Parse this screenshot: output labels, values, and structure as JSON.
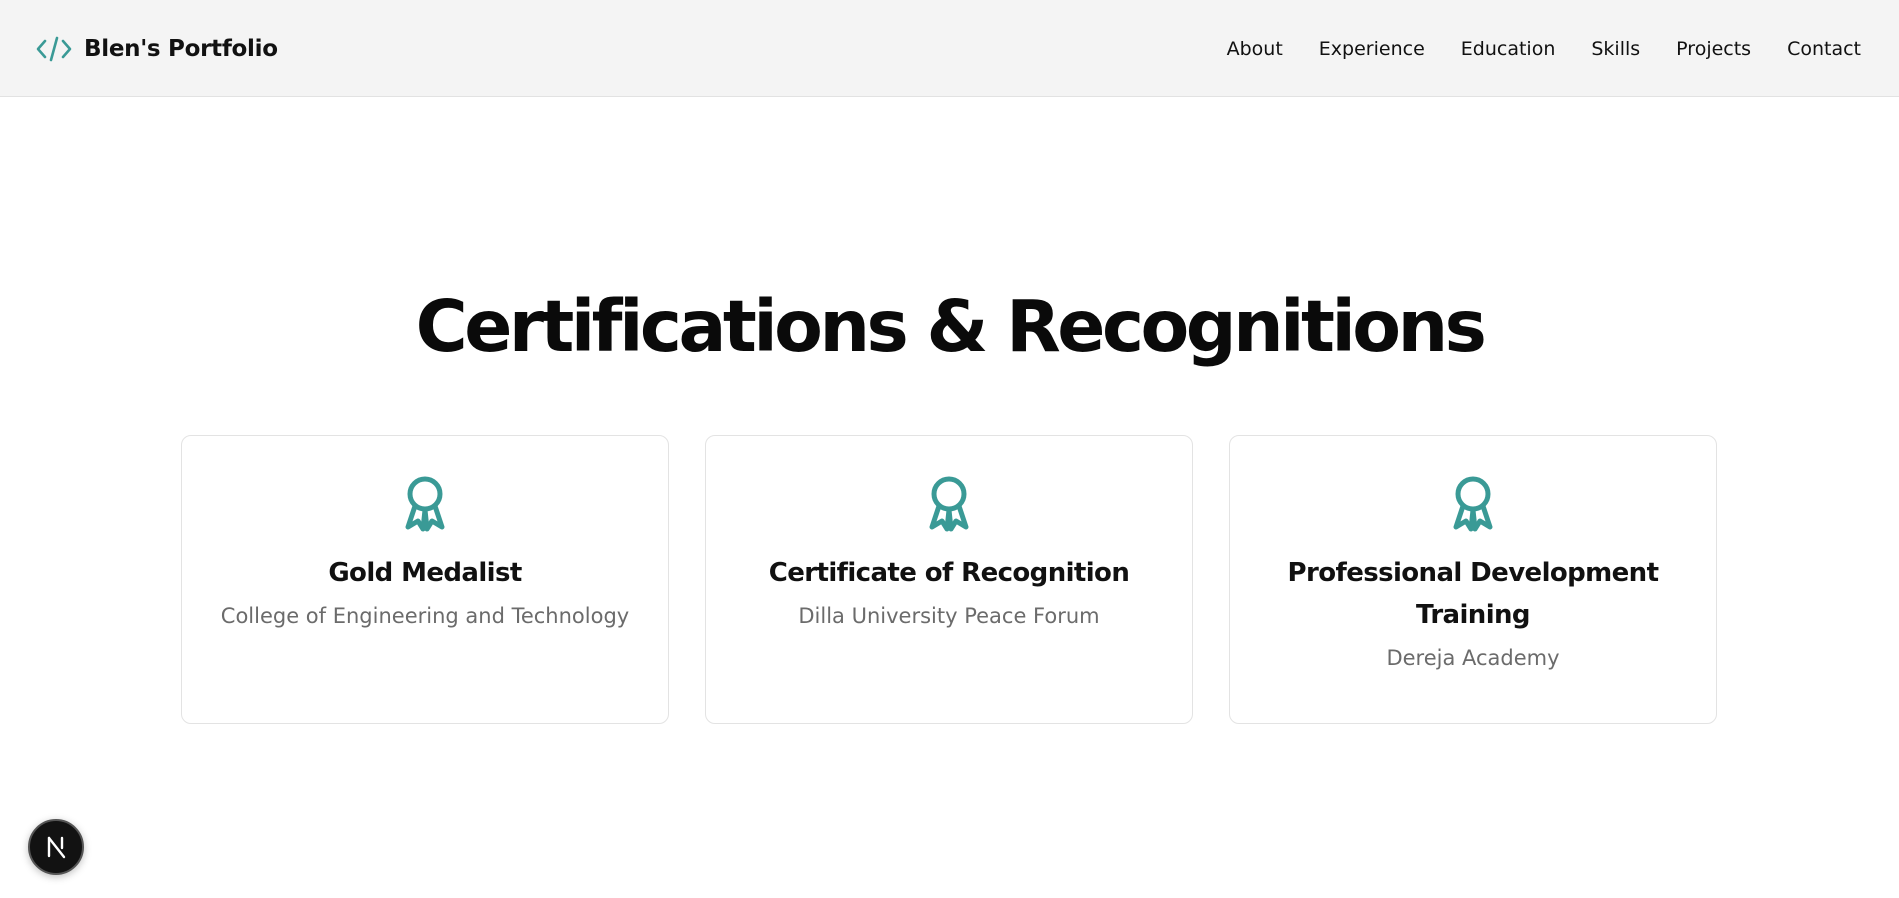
{
  "header": {
    "brand_icon": "code-icon",
    "brand_title": "Blen's Portfolio",
    "nav": [
      {
        "label": "About"
      },
      {
        "label": "Experience"
      },
      {
        "label": "Education"
      },
      {
        "label": "Skills"
      },
      {
        "label": "Projects"
      },
      {
        "label": "Contact"
      }
    ]
  },
  "section": {
    "title": "Certifications & Recognitions",
    "cards": [
      {
        "icon": "award-icon",
        "title": "Gold Medalist",
        "subtitle": "College of Engineering and Technology"
      },
      {
        "icon": "award-icon",
        "title": "Certificate of Recognition",
        "subtitle": "Dilla University Peace Forum"
      },
      {
        "icon": "award-icon",
        "title": "Professional Development Training",
        "subtitle": "Dereja Academy"
      }
    ]
  },
  "dev_badge": {
    "icon": "nextjs-icon",
    "letter": "N"
  },
  "colors": {
    "accent": "#3a9a96",
    "nav_background": "#f4f4f4",
    "text": "#111111",
    "muted": "#6b6b6b"
  }
}
